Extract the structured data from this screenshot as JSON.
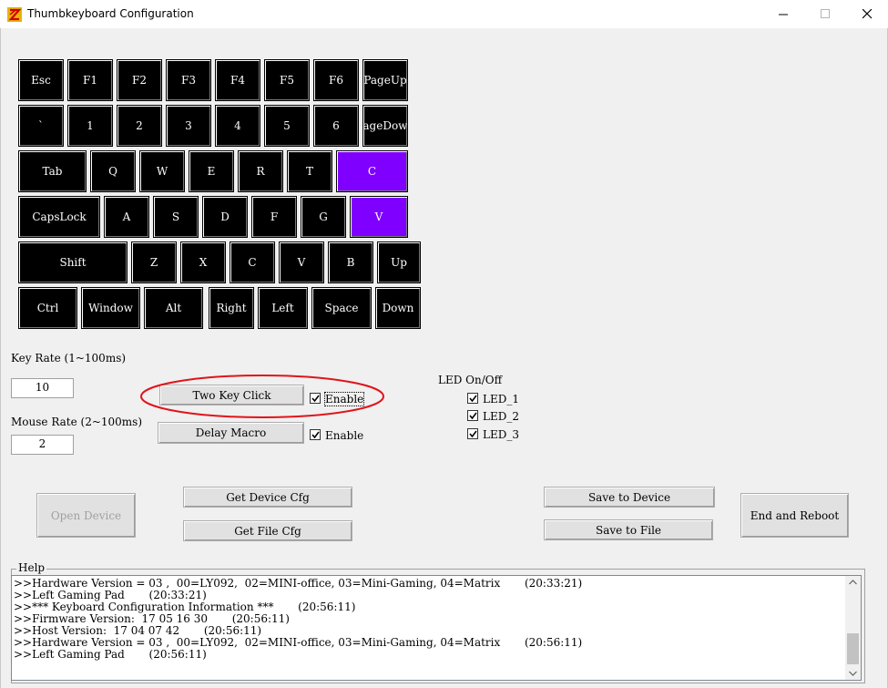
{
  "window": {
    "title": "Thumbkeyboard Configuration",
    "accent": "#8000ff"
  },
  "keyboard": {
    "rows": [
      [
        "Esc",
        "F1",
        "F2",
        "F3",
        "F4",
        "F5",
        "F6",
        "PageUp"
      ],
      [
        "`",
        "1",
        "2",
        "3",
        "4",
        "5",
        "6",
        "PageDown"
      ],
      [
        "Tab",
        "Q",
        "W",
        "E",
        "R",
        "T",
        "C"
      ],
      [
        "CapsLock",
        "A",
        "S",
        "D",
        "F",
        "G",
        "V"
      ],
      [
        "Shift",
        "Z",
        "X",
        "C",
        "V",
        "B",
        "Up"
      ],
      [
        "Ctrl",
        "Window",
        "Alt",
        "Right",
        "Left",
        "Space",
        "Down"
      ]
    ],
    "highlighted": [
      "2-6",
      "3-6"
    ]
  },
  "settings": {
    "key_rate_label": "Key Rate (1~100ms)",
    "key_rate_value": "10",
    "mouse_rate_label": "Mouse Rate (2~100ms)",
    "mouse_rate_value": "2",
    "two_key_click_label": "Two Key Click",
    "two_key_enable_label": "Enable",
    "two_key_enable_checked": true,
    "delay_macro_label": "Delay Macro",
    "delay_enable_label": "Enable",
    "delay_enable_checked": true
  },
  "led": {
    "title": "LED On/Off",
    "items": [
      {
        "label": "LED_1",
        "checked": true
      },
      {
        "label": "LED_2",
        "checked": true
      },
      {
        "label": "LED_3",
        "checked": true
      }
    ]
  },
  "buttons": {
    "open_device": "Open Device",
    "get_device_cfg": "Get Device Cfg",
    "get_file_cfg": "Get File Cfg",
    "save_to_device": "Save to Device",
    "save_to_file": "Save to File",
    "end_and_reboot": "End and Reboot"
  },
  "help": {
    "caption": "Help",
    "lines": [
      ">>Hardware Version = 03 ,  00=LY092,  02=MINI-office, 03=Mini-Gaming, 04=Matrix       (20:33:21)",
      ">>Left Gaming Pad       (20:33:21)",
      ">>*** Keyboard Configuration Information ***       (20:56:11)",
      ">>Firmware Version:  17 05 16 30       (20:56:11)",
      ">>Host Version:  17 04 07 42       (20:56:11)",
      ">>Hardware Version = 03 ,  00=LY092,  02=MINI-office, 03=Mini-Gaming, 04=Matrix       (20:56:11)",
      ">>Left Gaming Pad       (20:56:11)"
    ]
  }
}
